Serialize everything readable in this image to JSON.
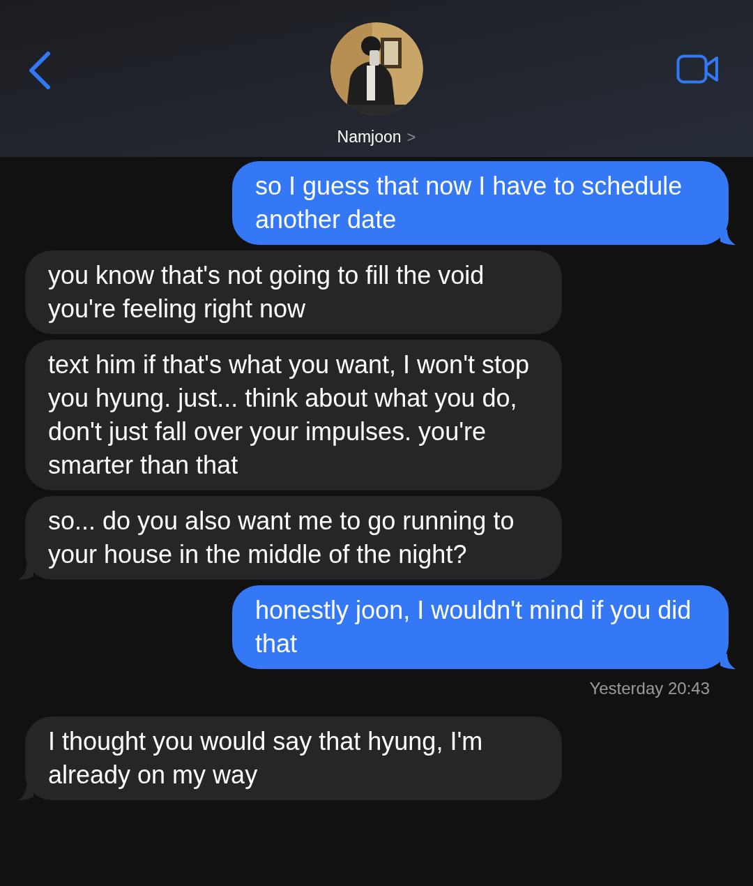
{
  "header": {
    "name": "Namjoon",
    "chevron": ">"
  },
  "messages": [
    {
      "kind": "sent",
      "text": "so I guess that now I have to schedule another date",
      "tail": true
    },
    {
      "kind": "received",
      "text": "you know that's not going to fill the void you're feeling right now",
      "tail": false
    },
    {
      "kind": "received",
      "text": "text him if that's what you want, I won't stop you hyung. just... think about what you do, don't just fall over your impulses. you're smarter than that",
      "tail": false
    },
    {
      "kind": "received",
      "text": "so... do you also want me to go running to your house in the middle of the night?",
      "tail": true
    },
    {
      "kind": "sent",
      "text": "honestly joon, I wouldn't mind if you did that",
      "tail": true
    },
    {
      "kind": "timestamp",
      "text": "Yesterday 20:43"
    },
    {
      "kind": "received",
      "text": "I thought you would say that hyung, I'm already on my way",
      "tail": true
    }
  ]
}
